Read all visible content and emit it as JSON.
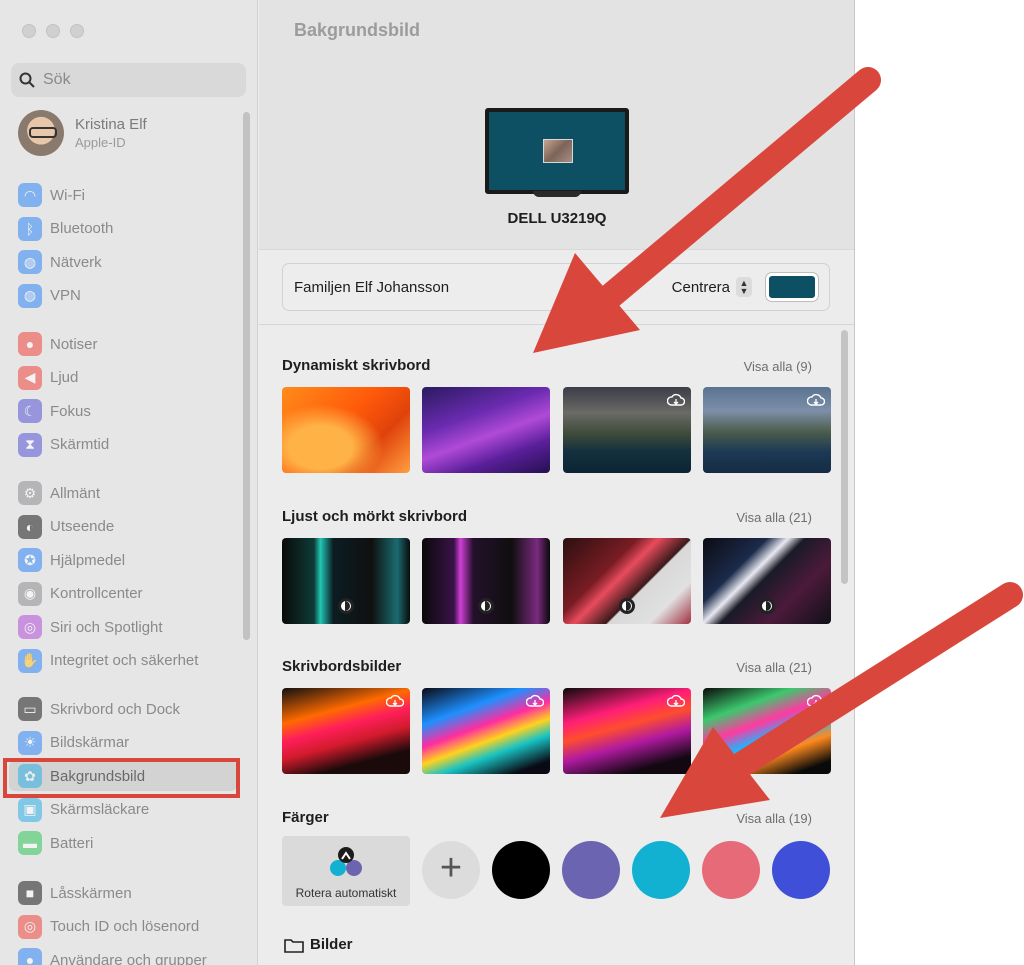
{
  "sidebar": {
    "search_placeholder": "Sök",
    "profile": {
      "name": "Kristina Elf",
      "subtitle": "Apple-ID"
    },
    "groups": [
      [
        {
          "label": "Wi-Fi",
          "icon": "wifi-icon",
          "color": "#2f86f7"
        },
        {
          "label": "Bluetooth",
          "icon": "bluetooth-icon",
          "color": "#2f86f7"
        },
        {
          "label": "Nätverk",
          "icon": "globe-icon",
          "color": "#2f86f7"
        },
        {
          "label": "VPN",
          "icon": "vpn-icon",
          "color": "#2f86f7"
        }
      ],
      [
        {
          "label": "Notiser",
          "icon": "bell-icon",
          "color": "#f0473f"
        },
        {
          "label": "Ljud",
          "icon": "speaker-icon",
          "color": "#f0473f"
        },
        {
          "label": "Fokus",
          "icon": "moon-icon",
          "color": "#5856d6"
        },
        {
          "label": "Skärmtid",
          "icon": "hourglass-icon",
          "color": "#5856d6"
        }
      ],
      [
        {
          "label": "Allmänt",
          "icon": "gear-icon",
          "color": "#8e8e93"
        },
        {
          "label": "Utseende",
          "icon": "appearance-icon",
          "color": "#1c1c1e"
        },
        {
          "label": "Hjälpmedel",
          "icon": "accessibility-icon",
          "color": "#2f86f7"
        },
        {
          "label": "Kontrollcenter",
          "icon": "toggles-icon",
          "color": "#8e8e93"
        },
        {
          "label": "Siri och Spotlight",
          "icon": "siri-icon",
          "color": "#b04fd8"
        },
        {
          "label": "Integritet och säkerhet",
          "icon": "hand-icon",
          "color": "#2f86f7"
        }
      ],
      [
        {
          "label": "Skrivbord och Dock",
          "icon": "dock-icon",
          "color": "#1c1c1e"
        },
        {
          "label": "Bildskärmar",
          "icon": "sun-icon",
          "color": "#2f86f7"
        },
        {
          "label": "Bakgrundsbild",
          "icon": "flower-icon",
          "color": "#2fb0e8",
          "selected": true
        },
        {
          "label": "Skärmsläckare",
          "icon": "screensaver-icon",
          "color": "#2fb0e8"
        },
        {
          "label": "Batteri",
          "icon": "battery-icon",
          "color": "#34c759"
        }
      ],
      [
        {
          "label": "Låsskärmen",
          "icon": "lock-icon",
          "color": "#1c1c1e"
        },
        {
          "label": "Touch ID och lösenord",
          "icon": "fingerprint-icon",
          "color": "#f0473f"
        },
        {
          "label": "Användare och grupper",
          "icon": "users-icon",
          "color": "#2f86f7"
        }
      ]
    ]
  },
  "main": {
    "title": "Bakgrundsbild",
    "display_name": "DELL U3219Q",
    "current": {
      "name": "Familjen Elf Johansson",
      "fit": "Centrera",
      "fill_color": "#0d4f63"
    },
    "sections": [
      {
        "title": "Dynamiskt skrivbord",
        "show_all": "Visa alla (9)"
      },
      {
        "title": "Ljust och mörkt skrivbord",
        "show_all": "Visa alla (21)"
      },
      {
        "title": "Skrivbordsbilder",
        "show_all": "Visa alla (21)"
      },
      {
        "title": "Färger",
        "show_all": "Visa alla (19)"
      }
    ],
    "auto_rotate_label": "Rotera automatiskt",
    "colors": [
      "#000000",
      "#6b64b0",
      "#12b1d1",
      "#e66a78",
      "#3f4fd8"
    ],
    "folder_label": "Bilder"
  },
  "annotation_color": "#d9473c"
}
